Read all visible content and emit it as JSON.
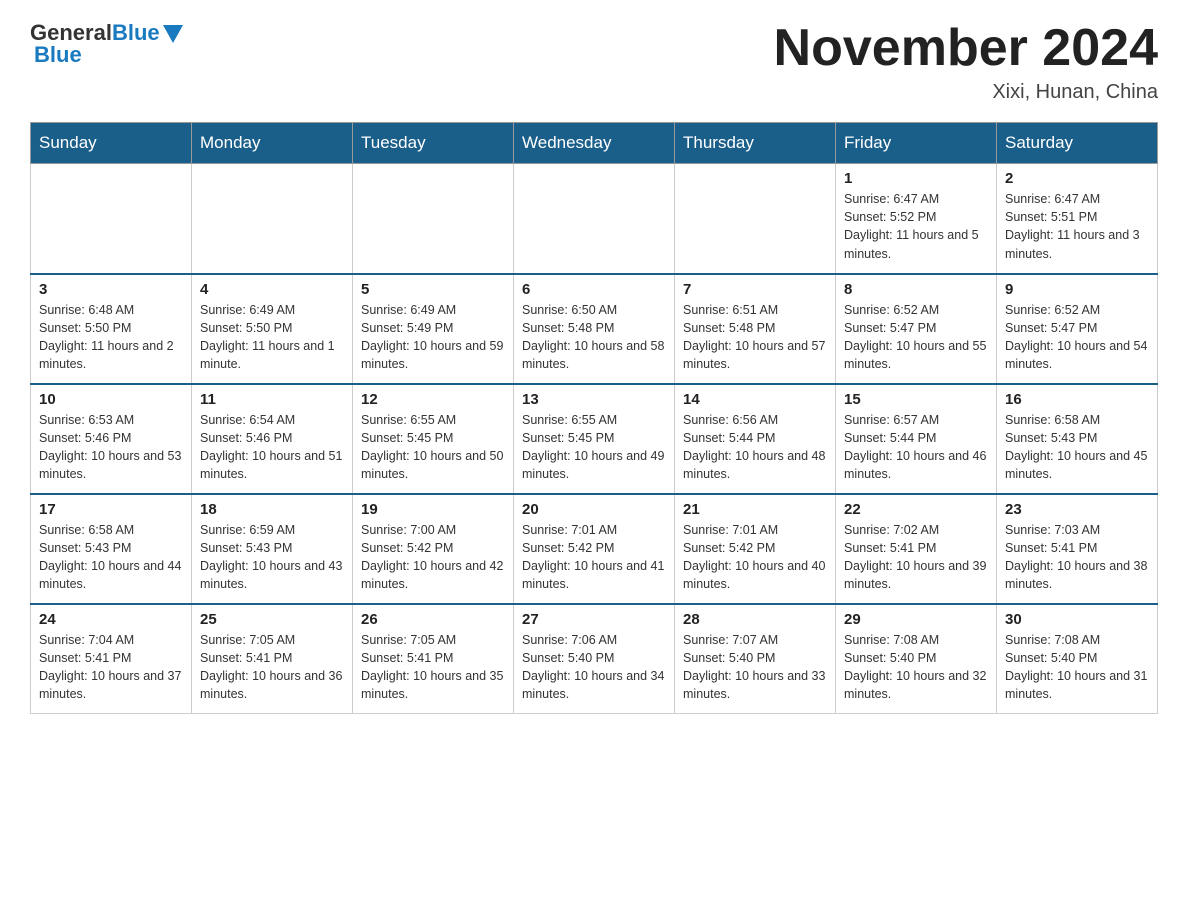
{
  "header": {
    "logo_general": "General",
    "logo_blue": "Blue",
    "month_title": "November 2024",
    "location": "Xixi, Hunan, China"
  },
  "days_of_week": [
    "Sunday",
    "Monday",
    "Tuesday",
    "Wednesday",
    "Thursday",
    "Friday",
    "Saturday"
  ],
  "weeks": [
    [
      {
        "day": "",
        "info": ""
      },
      {
        "day": "",
        "info": ""
      },
      {
        "day": "",
        "info": ""
      },
      {
        "day": "",
        "info": ""
      },
      {
        "day": "",
        "info": ""
      },
      {
        "day": "1",
        "info": "Sunrise: 6:47 AM\nSunset: 5:52 PM\nDaylight: 11 hours and 5 minutes."
      },
      {
        "day": "2",
        "info": "Sunrise: 6:47 AM\nSunset: 5:51 PM\nDaylight: 11 hours and 3 minutes."
      }
    ],
    [
      {
        "day": "3",
        "info": "Sunrise: 6:48 AM\nSunset: 5:50 PM\nDaylight: 11 hours and 2 minutes."
      },
      {
        "day": "4",
        "info": "Sunrise: 6:49 AM\nSunset: 5:50 PM\nDaylight: 11 hours and 1 minute."
      },
      {
        "day": "5",
        "info": "Sunrise: 6:49 AM\nSunset: 5:49 PM\nDaylight: 10 hours and 59 minutes."
      },
      {
        "day": "6",
        "info": "Sunrise: 6:50 AM\nSunset: 5:48 PM\nDaylight: 10 hours and 58 minutes."
      },
      {
        "day": "7",
        "info": "Sunrise: 6:51 AM\nSunset: 5:48 PM\nDaylight: 10 hours and 57 minutes."
      },
      {
        "day": "8",
        "info": "Sunrise: 6:52 AM\nSunset: 5:47 PM\nDaylight: 10 hours and 55 minutes."
      },
      {
        "day": "9",
        "info": "Sunrise: 6:52 AM\nSunset: 5:47 PM\nDaylight: 10 hours and 54 minutes."
      }
    ],
    [
      {
        "day": "10",
        "info": "Sunrise: 6:53 AM\nSunset: 5:46 PM\nDaylight: 10 hours and 53 minutes."
      },
      {
        "day": "11",
        "info": "Sunrise: 6:54 AM\nSunset: 5:46 PM\nDaylight: 10 hours and 51 minutes."
      },
      {
        "day": "12",
        "info": "Sunrise: 6:55 AM\nSunset: 5:45 PM\nDaylight: 10 hours and 50 minutes."
      },
      {
        "day": "13",
        "info": "Sunrise: 6:55 AM\nSunset: 5:45 PM\nDaylight: 10 hours and 49 minutes."
      },
      {
        "day": "14",
        "info": "Sunrise: 6:56 AM\nSunset: 5:44 PM\nDaylight: 10 hours and 48 minutes."
      },
      {
        "day": "15",
        "info": "Sunrise: 6:57 AM\nSunset: 5:44 PM\nDaylight: 10 hours and 46 minutes."
      },
      {
        "day": "16",
        "info": "Sunrise: 6:58 AM\nSunset: 5:43 PM\nDaylight: 10 hours and 45 minutes."
      }
    ],
    [
      {
        "day": "17",
        "info": "Sunrise: 6:58 AM\nSunset: 5:43 PM\nDaylight: 10 hours and 44 minutes."
      },
      {
        "day": "18",
        "info": "Sunrise: 6:59 AM\nSunset: 5:43 PM\nDaylight: 10 hours and 43 minutes."
      },
      {
        "day": "19",
        "info": "Sunrise: 7:00 AM\nSunset: 5:42 PM\nDaylight: 10 hours and 42 minutes."
      },
      {
        "day": "20",
        "info": "Sunrise: 7:01 AM\nSunset: 5:42 PM\nDaylight: 10 hours and 41 minutes."
      },
      {
        "day": "21",
        "info": "Sunrise: 7:01 AM\nSunset: 5:42 PM\nDaylight: 10 hours and 40 minutes."
      },
      {
        "day": "22",
        "info": "Sunrise: 7:02 AM\nSunset: 5:41 PM\nDaylight: 10 hours and 39 minutes."
      },
      {
        "day": "23",
        "info": "Sunrise: 7:03 AM\nSunset: 5:41 PM\nDaylight: 10 hours and 38 minutes."
      }
    ],
    [
      {
        "day": "24",
        "info": "Sunrise: 7:04 AM\nSunset: 5:41 PM\nDaylight: 10 hours and 37 minutes."
      },
      {
        "day": "25",
        "info": "Sunrise: 7:05 AM\nSunset: 5:41 PM\nDaylight: 10 hours and 36 minutes."
      },
      {
        "day": "26",
        "info": "Sunrise: 7:05 AM\nSunset: 5:41 PM\nDaylight: 10 hours and 35 minutes."
      },
      {
        "day": "27",
        "info": "Sunrise: 7:06 AM\nSunset: 5:40 PM\nDaylight: 10 hours and 34 minutes."
      },
      {
        "day": "28",
        "info": "Sunrise: 7:07 AM\nSunset: 5:40 PM\nDaylight: 10 hours and 33 minutes."
      },
      {
        "day": "29",
        "info": "Sunrise: 7:08 AM\nSunset: 5:40 PM\nDaylight: 10 hours and 32 minutes."
      },
      {
        "day": "30",
        "info": "Sunrise: 7:08 AM\nSunset: 5:40 PM\nDaylight: 10 hours and 31 minutes."
      }
    ]
  ]
}
